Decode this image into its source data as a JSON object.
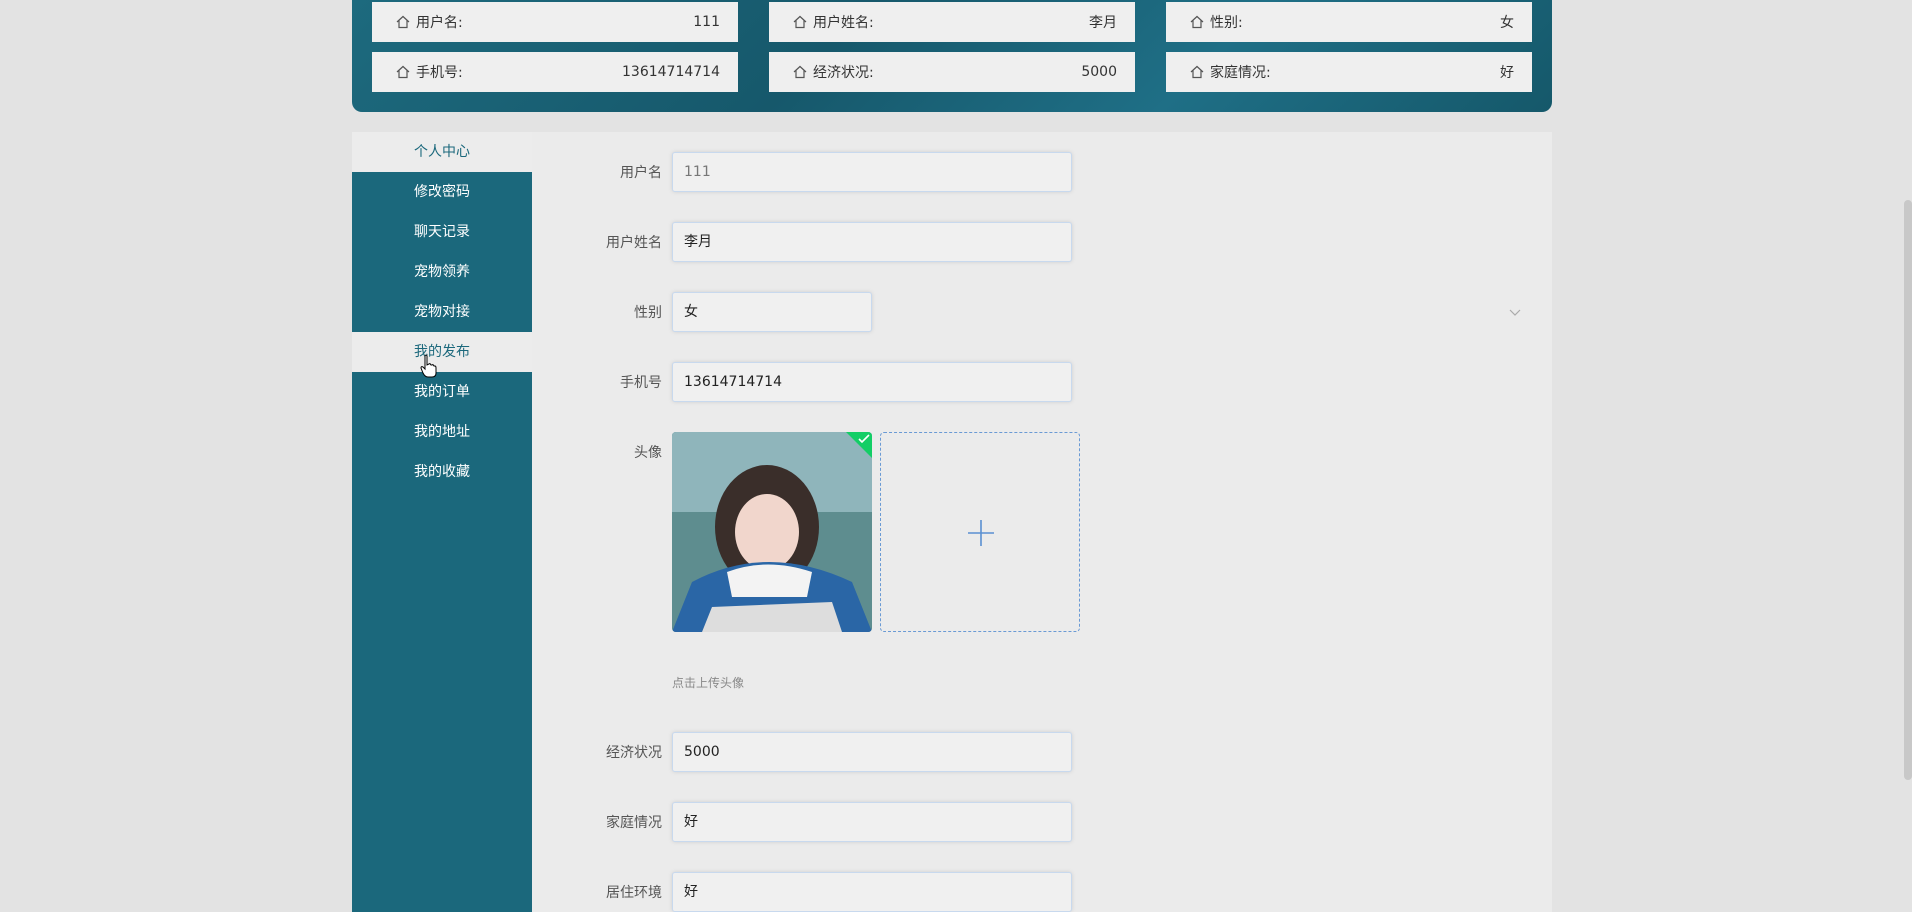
{
  "profile_cards": [
    {
      "label": "用户名:",
      "value": "111"
    },
    {
      "label": "用户姓名:",
      "value": "李月"
    },
    {
      "label": "性别:",
      "value": "女"
    },
    {
      "label": "手机号:",
      "value": "13614714714"
    },
    {
      "label": "经济状况:",
      "value": "5000"
    },
    {
      "label": "家庭情况:",
      "value": "好"
    }
  ],
  "sidebar": {
    "items": [
      {
        "label": "个人中心"
      },
      {
        "label": "修改密码"
      },
      {
        "label": "聊天记录"
      },
      {
        "label": "宠物领养"
      },
      {
        "label": "宠物对接"
      },
      {
        "label": "我的发布"
      },
      {
        "label": "我的订单"
      },
      {
        "label": "我的地址"
      },
      {
        "label": "我的收藏"
      }
    ]
  },
  "form": {
    "username": {
      "label": "用户名",
      "value": "111"
    },
    "name": {
      "label": "用户姓名",
      "value": "李月"
    },
    "gender": {
      "label": "性别",
      "value": "女"
    },
    "phone": {
      "label": "手机号",
      "value": "13614714714"
    },
    "avatar": {
      "label": "头像",
      "hint": "点击上传头像"
    },
    "economy": {
      "label": "经济状况",
      "value": "5000"
    },
    "family": {
      "label": "家庭情况",
      "value": "好"
    },
    "living": {
      "label": "居住环境",
      "value": "好"
    }
  },
  "icons": {
    "card_icon": "home-icon",
    "upload": "plus-icon",
    "success": "check-icon",
    "select": "chevron-down-icon"
  },
  "colors": {
    "primary": "#1b687c",
    "accent": "#409eff",
    "success": "#13ce66"
  }
}
